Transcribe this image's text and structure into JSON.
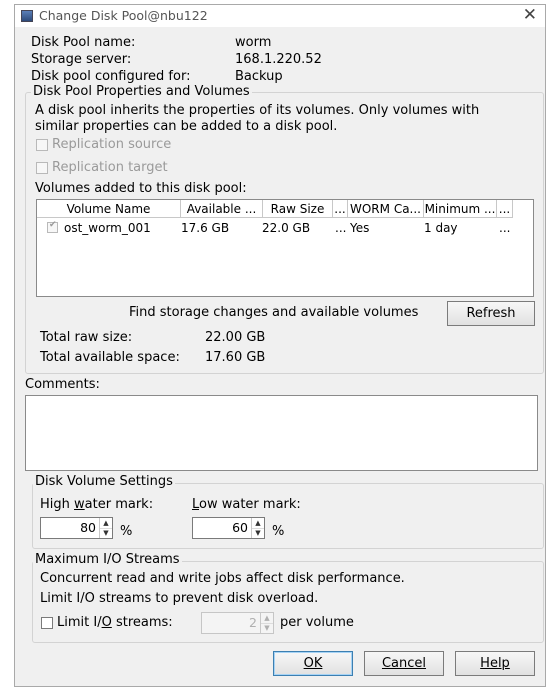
{
  "window": {
    "title": "Change Disk Pool@nbu122",
    "close": "✕"
  },
  "info": {
    "name_label": "Disk Pool name:",
    "name_value": "worm",
    "server_label": "Storage server:",
    "server_value": "168.1.220.52",
    "config_label": "Disk pool configured for:",
    "config_value": "Backup"
  },
  "props_group": {
    "title": "Disk Pool Properties and Volumes",
    "desc_line1": "A disk pool inherits the properties of its volumes. Only volumes with",
    "desc_line2": "similar properties can be added to a disk pool.",
    "replication_source": "Replication source",
    "replication_target": "Replication target",
    "volumes_label": "Volumes added to this disk pool:",
    "columns": [
      "Volume Name",
      "Available ...",
      "Raw Size",
      "...",
      "WORM Ca...",
      "Minimum ...",
      "..."
    ],
    "rows": [
      {
        "checked": true,
        "name": "ost_worm_001",
        "available": "17.6 GB",
        "raw": "22.0 GB",
        "col4": "...",
        "worm": "Yes",
        "minimum": "1 day",
        "col7": "..."
      }
    ],
    "find_label": "Find storage changes and available volumes",
    "refresh": "Refresh",
    "total_raw_label": "Total raw size:",
    "total_raw_value": "22.00 GB",
    "total_avail_label": "Total available space:",
    "total_avail_value": "17.60 GB"
  },
  "comments": {
    "label": "Comments:",
    "value": ""
  },
  "volume_settings": {
    "title": "Disk Volume Settings",
    "high_pre": "High ",
    "high_u": "w",
    "high_post": "ater mark:",
    "high_value": "80",
    "low_pre": "",
    "low_u": "L",
    "low_post": "ow water mark:",
    "low_value": "60",
    "percent": "%"
  },
  "io": {
    "title": "Maximum I/O Streams",
    "line1": "Concurrent read and write jobs affect disk performance.",
    "line2": "Limit I/O streams to prevent disk overload.",
    "limit_pre": "Limit I/",
    "limit_u": "O",
    "limit_post": " streams:",
    "limit_value": "2",
    "per_volume": "per volume"
  },
  "buttons": {
    "ok": "OK",
    "cancel": "Cancel",
    "help": "Help"
  }
}
